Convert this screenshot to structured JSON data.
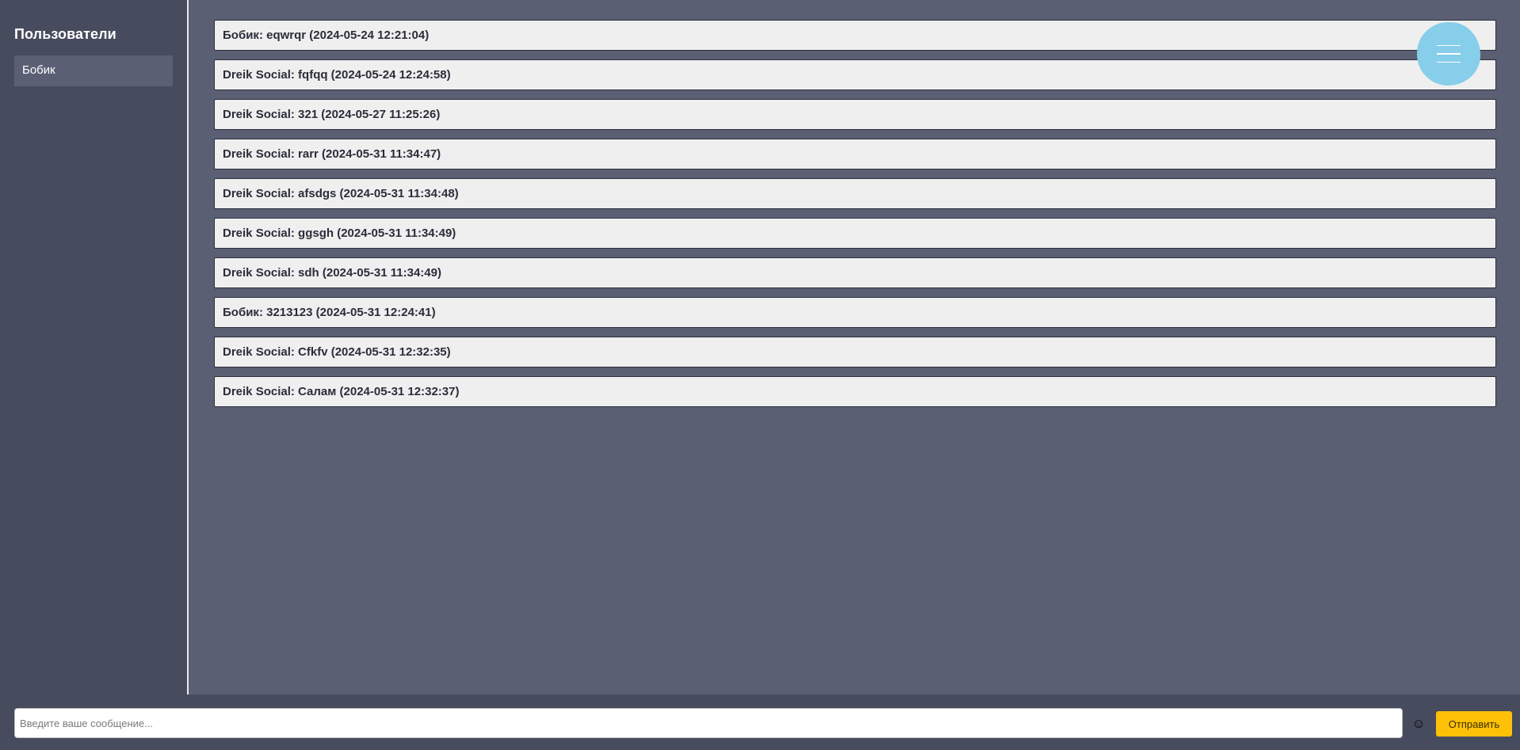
{
  "sidebar": {
    "title": "Пользователи",
    "users": [
      {
        "name": "Бобик"
      }
    ]
  },
  "messages": [
    {
      "text": "Бобик: eqwrqr (2024-05-24 12:21:04)"
    },
    {
      "text": "Dreik Social: fqfqq (2024-05-24 12:24:58)"
    },
    {
      "text": "Dreik Social: 321 (2024-05-27 11:25:26)"
    },
    {
      "text": "Dreik Social: rarr (2024-05-31 11:34:47)"
    },
    {
      "text": "Dreik Social: afsdgs (2024-05-31 11:34:48)"
    },
    {
      "text": "Dreik Social: ggsgh (2024-05-31 11:34:49)"
    },
    {
      "text": "Dreik Social: sdh (2024-05-31 11:34:49)"
    },
    {
      "text": "Бобик: 3213123 (2024-05-31 12:24:41)"
    },
    {
      "text": "Dreik Social: Cfkfv (2024-05-31 12:32:35)"
    },
    {
      "text": "Dreik Social: Салам (2024-05-31 12:32:37)"
    }
  ],
  "menu_button": {
    "icon": "hamburger-menu-icon",
    "color": "#87ceeb"
  },
  "composer": {
    "placeholder": "Введите ваше сообщение...",
    "value": "",
    "emoji_icon": "☺",
    "send_label": "Отправить"
  },
  "colors": {
    "background": "#5a5f74",
    "sidebar": "#474b5e",
    "message_bg": "#efefef",
    "send_button": "#ffc107",
    "menu_button": "#87ceeb"
  }
}
